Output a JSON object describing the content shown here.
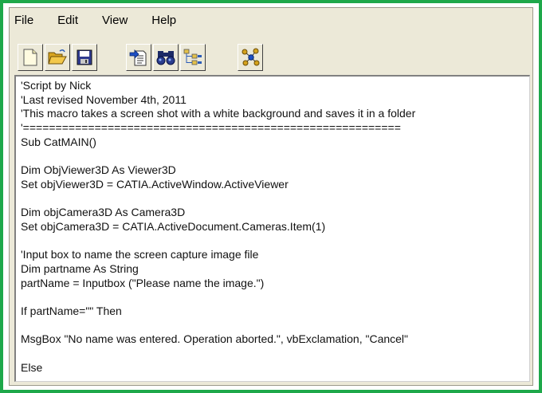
{
  "menu": {
    "items": [
      "File",
      "Edit",
      "View",
      "Help"
    ]
  },
  "toolbar": {
    "buttons": [
      {
        "name": "new-file-icon"
      },
      {
        "name": "open-folder-icon"
      },
      {
        "name": "save-icon"
      },
      {
        "name": "insert-file-icon"
      },
      {
        "name": "find-binoculars-icon"
      },
      {
        "name": "object-browser-icon"
      },
      {
        "name": "network-graph-icon"
      }
    ]
  },
  "editor": {
    "lines": [
      "'Script by Nick",
      "'Last revised November 4th, 2011",
      "'This macro takes a screen shot with a white background and saves it in a folder",
      "'==========================================================",
      "Sub CatMAIN()",
      "",
      "Dim ObjViewer3D As Viewer3D",
      "Set objViewer3D = CATIA.ActiveWindow.ActiveViewer",
      "",
      "Dim objCamera3D As Camera3D",
      "Set objCamera3D = CATIA.ActiveDocument.Cameras.Item(1)",
      "",
      "'Input box to name the screen capture image file",
      "Dim partname As String",
      "partName = Inputbox (\"Please name the image.\")",
      "",
      "If partName=\"\" Then",
      "",
      "MsgBox \"No name was entered. Operation aborted.\", vbExclamation, \"Cancel\"",
      "",
      "Else"
    ]
  },
  "colors": {
    "frame_border": "#1ea84a",
    "window_bg": "#ece9d8"
  }
}
